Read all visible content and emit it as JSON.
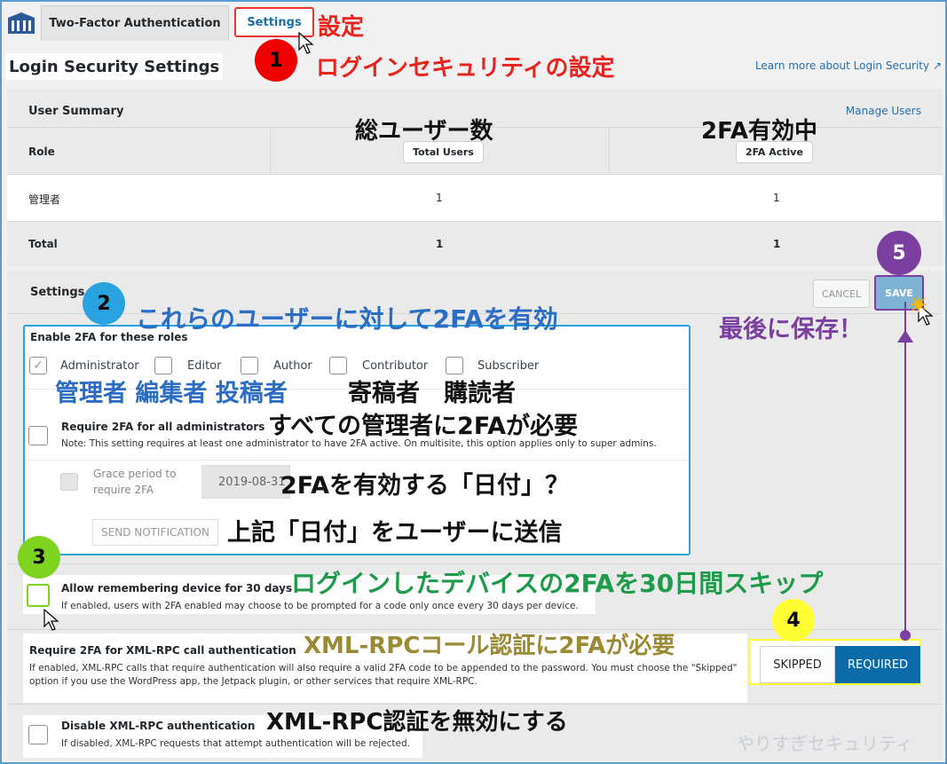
{
  "tabs": {
    "two_factor": "Two-Factor Authentication",
    "settings": "Settings"
  },
  "page": {
    "title": "Login Security Settings",
    "learn_more": "Learn more about Login Security"
  },
  "summary": {
    "heading": "User Summary",
    "manage_users": "Manage Users",
    "col_role": "Role",
    "col_total": "Total Users",
    "col_active": "2FA Active",
    "rows": [
      {
        "role": "管理者",
        "total": "1",
        "active": "1"
      },
      {
        "role": "Total",
        "total": "1",
        "active": "1"
      }
    ]
  },
  "settings": {
    "heading": "Settings",
    "cancel": "CANCEL",
    "save": "SAVE",
    "enable_roles_label": "Enable 2FA for these roles",
    "roles": [
      {
        "label": "Administrator",
        "checked": true
      },
      {
        "label": "Editor",
        "checked": false
      },
      {
        "label": "Author",
        "checked": false
      },
      {
        "label": "Contributor",
        "checked": false
      },
      {
        "label": "Subscriber",
        "checked": false
      }
    ],
    "require_admins_label": "Require 2FA for all administrators",
    "require_admins_note": "Note: This setting requires at least one administrator to have 2FA active. On multisite, this option applies only to super admins.",
    "grace_label_1": "Grace period to",
    "grace_label_2": "require 2FA",
    "grace_date": "2019-08-31",
    "send_notification": "SEND NOTIFICATION",
    "remember_label": "Allow remembering device for 30 days",
    "remember_note": "If enabled, users with 2FA enabled may choose to be prompted for a code only once every 30 days per device.",
    "xmlrpc_label": "Require 2FA for XML-RPC call authentication",
    "xmlrpc_note_1": "If enabled, XML-RPC calls that require authentication will also require a valid 2FA code to be appended to the password. You must choose the \"Skipped\"",
    "xmlrpc_note_2": "option if you use the WordPress app, the Jetpack plugin, or other services that require XML-RPC.",
    "skipped": "SKIPPED",
    "required": "REQUIRED",
    "disable_xmlrpc_label": "Disable XML-RPC authentication",
    "disable_xmlrpc_note": "If disabled, XML-RPC requests that attempt authentication will be rejected."
  },
  "annotations": {
    "n1": "1",
    "n2": "2",
    "n3": "3",
    "n4": "4",
    "n5": "5",
    "settings_ja": "設定",
    "login_security_ja": "ログインセキュリティの設定",
    "total_users_ja": "総ユーザー数",
    "active_ja": "2FA有効中",
    "enable_roles_ja": "これらのユーザーに対して2FAを有効",
    "roles_ja_blue": "管理者 編集者 投稿者",
    "roles_ja_black": "寄稿者　購読者",
    "require_admins_ja": "すべての管理者に2FAが必要",
    "grace_ja": "2FAを有効する「日付」？",
    "send_ja": "上記「日付」をユーザーに送信",
    "remember_ja": "ログインしたデバイスの2FAを30日間スキップ",
    "xmlrpc_ja": "XML-RPCコール認証に2FAが必要",
    "disable_xmlrpc_ja": "XML-RPC認証を無効にする",
    "save_ja": "最後に保存！",
    "watermark": "やりすぎセキュリティ"
  }
}
